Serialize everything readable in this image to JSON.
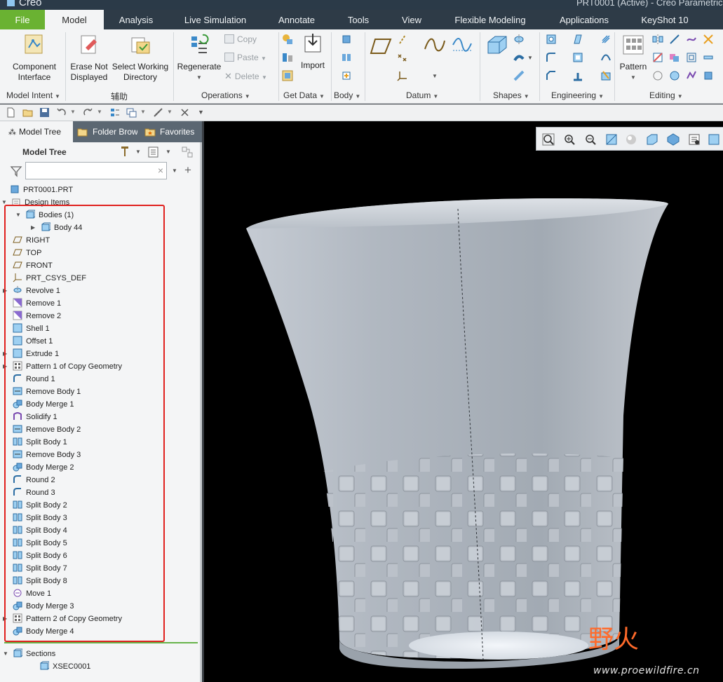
{
  "app": {
    "logo_text": "Creo",
    "window_title": "PRT0001 (Active) - Creo Parametric"
  },
  "ribbon_tabs": [
    "File",
    "Model",
    "Analysis",
    "Live Simulation",
    "Annotate",
    "Tools",
    "View",
    "Flexible Modeling",
    "Applications",
    "KeyShot 10"
  ],
  "ribbon": {
    "component_interface": "Component\nInterface",
    "erase_not_displayed": "Erase Not\nDisplayed",
    "select_working_directory": "Select Working\nDirectory",
    "regenerate": "Regenerate",
    "copy": "Copy",
    "paste": "Paste",
    "delete": "Delete",
    "import": "Import",
    "pattern": "Pattern",
    "groups": {
      "model_intent": "Model Intent",
      "aux": "辅助",
      "operations": "Operations",
      "get_data": "Get Data",
      "body": "Body",
      "datum": "Datum",
      "shapes": "Shapes",
      "engineering": "Engineering",
      "editing": "Editing"
    }
  },
  "panel": {
    "tabs": [
      "Model Tree",
      "Folder Browser",
      "Favorites"
    ],
    "tree_title": "Model Tree",
    "filter_value": ""
  },
  "tree": {
    "root": "PRT0001.PRT",
    "design_items": "Design Items",
    "bodies": "Bodies (1)",
    "body44": "Body 44",
    "features": [
      "RIGHT",
      "TOP",
      "FRONT",
      "PRT_CSYS_DEF",
      "Revolve 1",
      "Remove 1",
      "Remove 2",
      "Shell 1",
      "Offset 1",
      "Extrude 1",
      "Pattern 1 of Copy Geometry",
      "Round 1",
      "Remove Body 1",
      "Body Merge 1",
      "Solidify 1",
      "Remove Body 2",
      "Split Body 1",
      "Remove Body 3",
      "Body Merge 2",
      "Round 2",
      "Round 3",
      "Split Body 2",
      "Split Body 3",
      "Split Body 4",
      "Split Body 5",
      "Split Body 6",
      "Split Body 7",
      "Split Body 8",
      "Move 1",
      "Body Merge 3",
      "Pattern 2 of Copy Geometry",
      "Body Merge 4"
    ],
    "sections": "Sections",
    "xsec": "XSEC0001"
  },
  "watermark": {
    "cn": "野火",
    "url": "www.proewildfire.cn"
  },
  "colors": {
    "file_tab": "#6ab232",
    "ribbon_bg": "#f3f4f5",
    "highlight_box": "#e0201e",
    "model": "#a9b0b9"
  }
}
